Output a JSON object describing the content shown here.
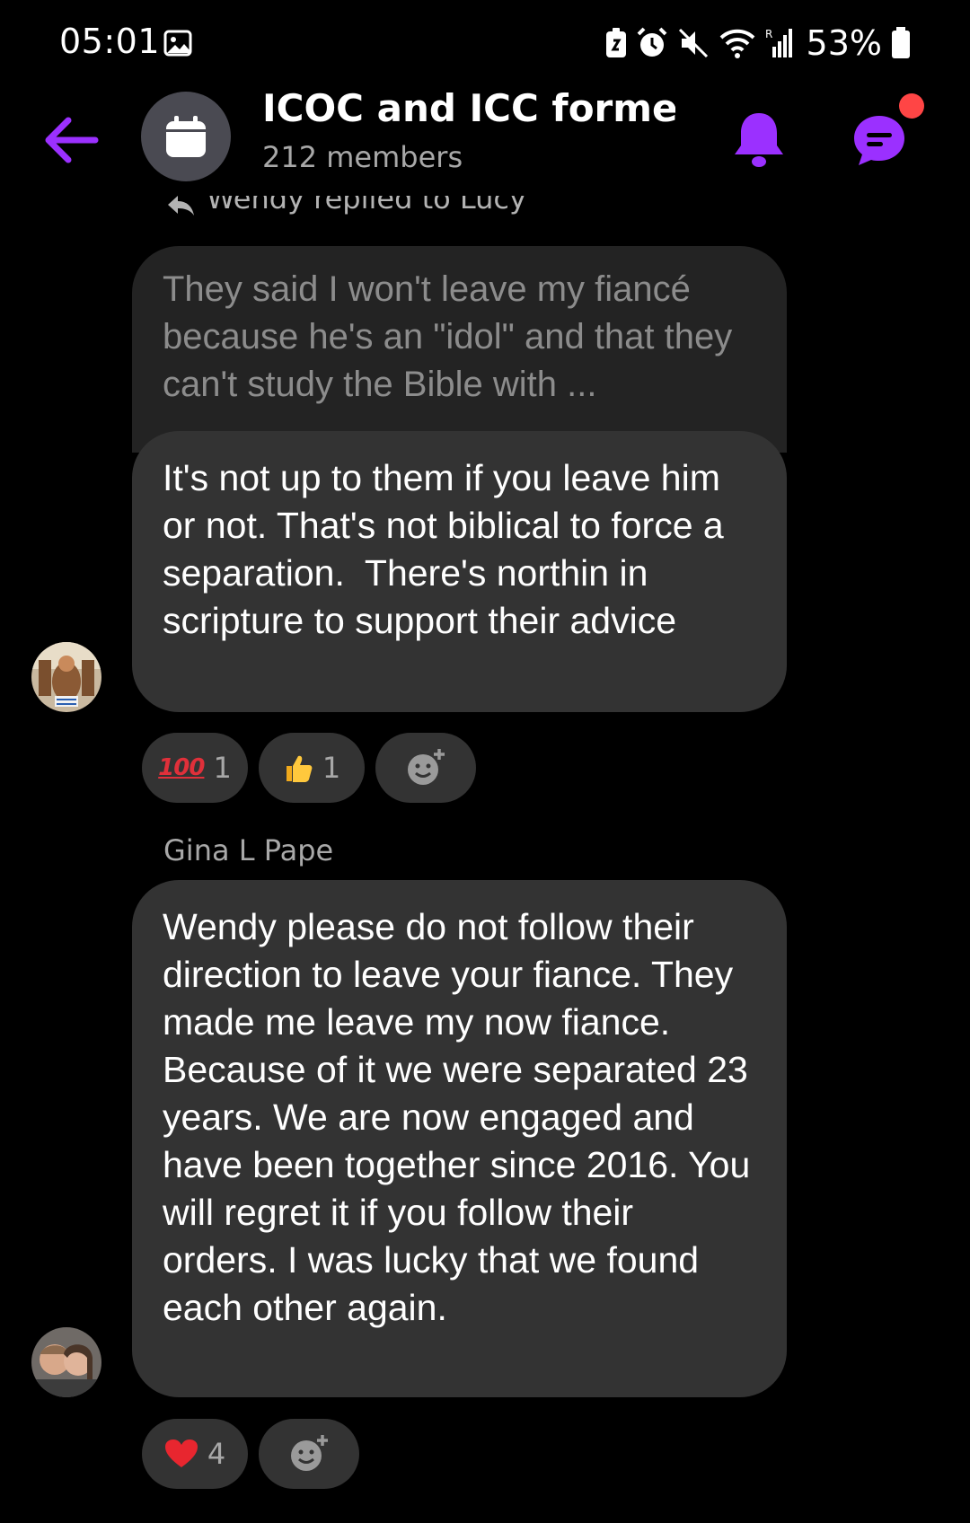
{
  "status_bar": {
    "time": "05:01",
    "battery": "53%"
  },
  "header": {
    "title": "ICOC and ICC former...",
    "subtitle": "212 members"
  },
  "reply": {
    "label": "Wendy replied to Lucy",
    "quoted_text": "They said I won't leave my fiancé because he's an \"idol\" and that they can't study the Bible with ..."
  },
  "messages": [
    {
      "text": "It's not up to them if you leave him or not. That's not biblical to force a separation.  There's northin in scripture to support their advice",
      "reactions": [
        {
          "emoji": "100",
          "count": "1"
        },
        {
          "emoji": "thumbs-up",
          "count": "1"
        }
      ]
    },
    {
      "sender": "Gina L Pape",
      "text": "Wendy please do not follow their direction to leave your fiance. They made me leave my now fiance. Because of it we were separated 23 years. We are now engaged and have been together since 2016. You will regret it if you follow their orders. I was lucky that we found each other again.",
      "reactions": [
        {
          "emoji": "red-heart",
          "count": "4"
        }
      ]
    }
  ],
  "colors": {
    "accent": "#9b30ff",
    "bubble": "#333333",
    "notification_dot": "#ff4545"
  }
}
